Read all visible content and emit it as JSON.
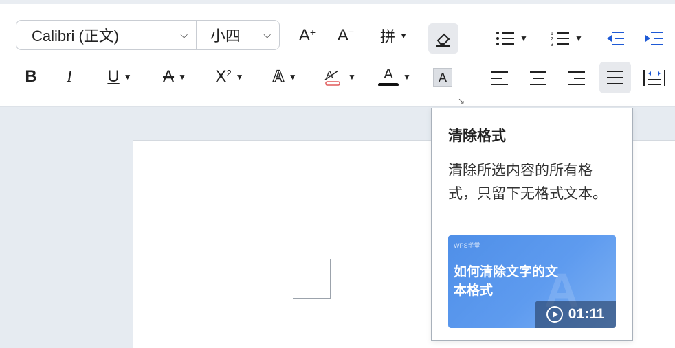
{
  "font": {
    "name": "Calibri (正文)",
    "size": "小四"
  },
  "toolbar": {
    "grow_font": "A",
    "shrink_font": "A",
    "phonetic_char": "拼",
    "superscript_base": "X",
    "superscript_exp": "2",
    "bold": "B",
    "italic": "I",
    "underline": "U",
    "strike": "A",
    "text_effect": "A",
    "font_color": "A",
    "char_shading": "A",
    "font_color_bar": "#111111"
  },
  "tooltip": {
    "title": "清除格式",
    "description": "清除所选内容的所有格式，只留下无格式文本。",
    "video_brand": "WPS学堂",
    "video_title": "如何清除文字的文本格式",
    "video_duration": "01:11"
  },
  "colors": {
    "accent": "#1e5ad6",
    "thumb": "#5e9bef"
  }
}
